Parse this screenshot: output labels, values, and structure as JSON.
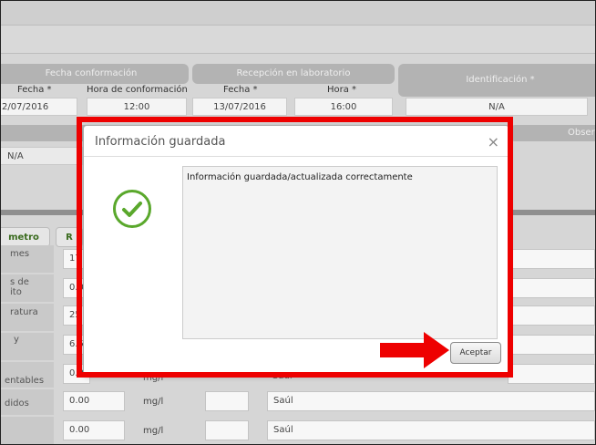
{
  "header": {
    "sections": {
      "fecha_conformacion": "Fecha conformación",
      "recepcion": "Recepción en laboratorio",
      "identificacion": "Identificación *"
    },
    "columns": {
      "fecha": "Fecha *",
      "hora_conformacion": "Hora de conformación",
      "fecha2": "Fecha *",
      "hora": "Hora *"
    },
    "values": {
      "fecha": "2/07/2016",
      "hora_conformacion": "12:00",
      "fecha2": "13/07/2016",
      "hora": "16:00",
      "identificacion": "N/A"
    },
    "observ_label": "Obser",
    "na_cell": "N/A"
  },
  "parameters": {
    "tab_parametro": "metro",
    "tab_r": "R",
    "rows": [
      {
        "label": "mes",
        "value": "17"
      },
      {
        "label": "s de\nito",
        "value": "0.0"
      },
      {
        "label": "ratura",
        "value": "25"
      },
      {
        "label": "y",
        "value": "6.5"
      },
      {
        "label": "entables",
        "value": "0.0"
      },
      {
        "label": "didos",
        "value": "0.00",
        "unit": "mg/l",
        "person": "Saúl"
      },
      {
        "label": "",
        "value": "0.00",
        "unit": "mg/l",
        "person": "Saúl"
      }
    ],
    "hidden_row_unit": "mg/l",
    "hidden_row_person": "Saúl"
  },
  "modal": {
    "title": "Información guardada",
    "close_symbol": "×",
    "message": "Información guardada/actualizada correctamente",
    "accept_label": "Aceptar"
  },
  "colors": {
    "highlight": "#ee0000",
    "success": "#5aa82c"
  }
}
